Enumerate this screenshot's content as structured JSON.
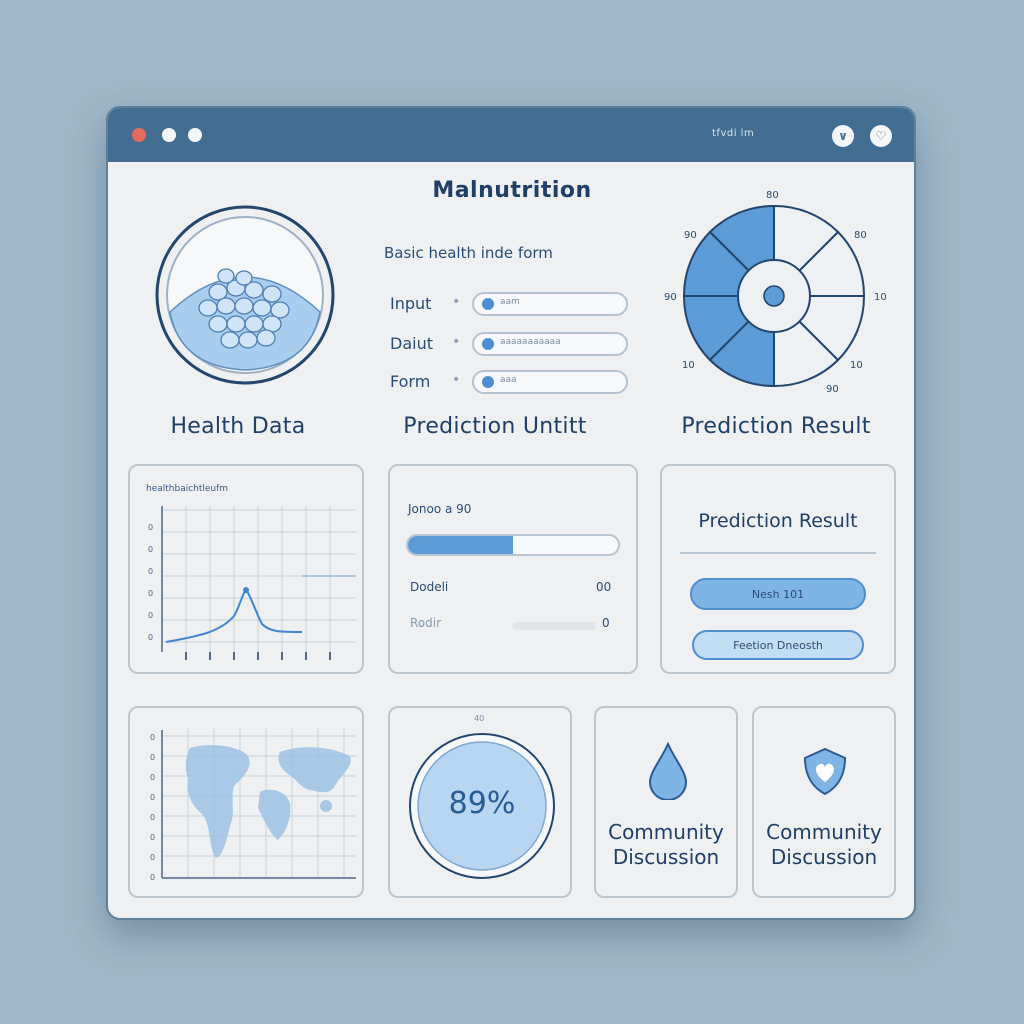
{
  "window": {
    "titlebar_text": "tfvdi lm",
    "btn1_icon": "chevron-down-icon",
    "btn2_icon": "heart-icon"
  },
  "header": {
    "title": "Malnutrition",
    "subtitle": "Basic health inde form"
  },
  "form": {
    "rows": [
      {
        "label": "Input",
        "value": "aam"
      },
      {
        "label": "Daiut",
        "value": "aaaaaaaaaaa"
      },
      {
        "label": "Form",
        "value": "aaa"
      }
    ]
  },
  "sections": {
    "health_data": "Health Data",
    "prediction_input": "Prediction Untitt",
    "prediction_result": "Prediction Result"
  },
  "wheel": {
    "labels": [
      "80",
      "90",
      "80",
      "90",
      "10",
      "10",
      "10",
      "90"
    ]
  },
  "chart_card": {
    "header": "healthbaichtleufm",
    "y_ticks": [
      "0",
      "0",
      "0",
      "0",
      "0",
      "0"
    ]
  },
  "input_card": {
    "header": "Jonoo a 90",
    "progress": 0.5,
    "row1_label": "Dodeli",
    "row1_value": "00",
    "row2_label": "Rodir",
    "row2_value": "0"
  },
  "result_card": {
    "title": "Prediction Result",
    "button1": "Nesh 101",
    "button2": "Feetion Dneosth"
  },
  "map_card": {
    "y_ticks": [
      "0",
      "0",
      "0",
      "0",
      "0",
      "0",
      "0",
      "0"
    ]
  },
  "gauge": {
    "value_text": "89%",
    "top_label": "40"
  },
  "community": [
    {
      "title": "Community Discussion",
      "icon": "water-drop-icon"
    },
    {
      "title": "Community Discussion",
      "icon": "heart-shield-icon"
    }
  ],
  "colors": {
    "accent": "#4e8fd1",
    "titlebar": "#436e91",
    "background": "#9fb7c8"
  }
}
